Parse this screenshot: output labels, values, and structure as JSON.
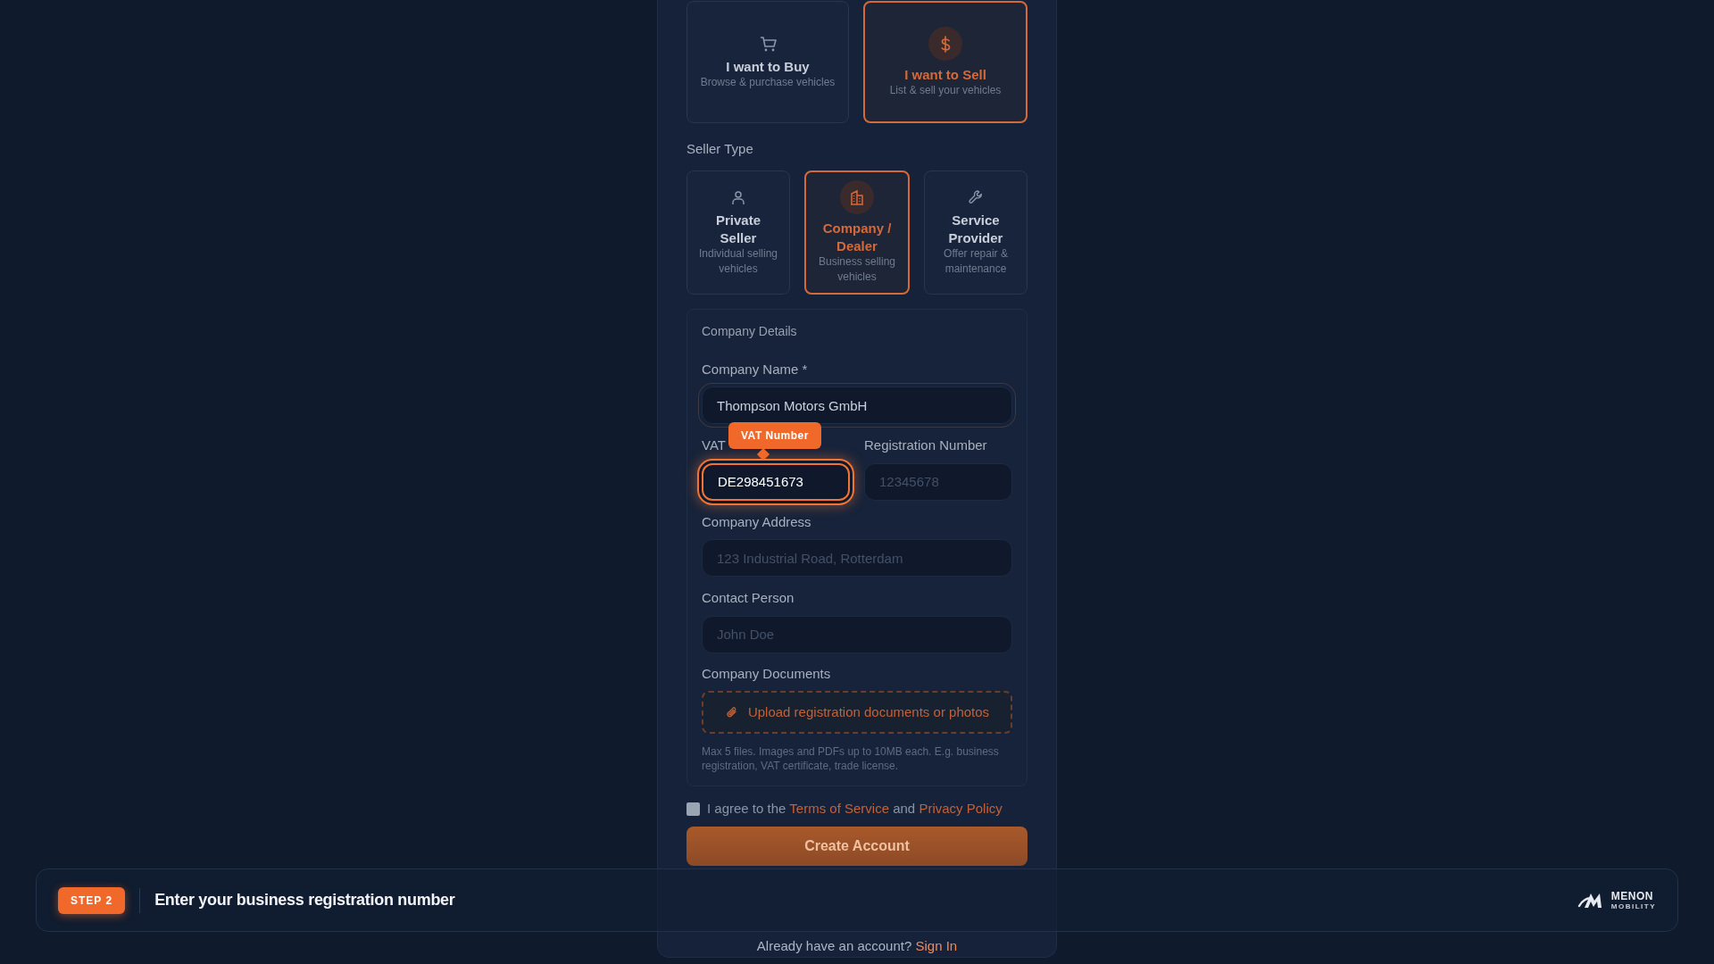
{
  "purpose": [
    {
      "title": "I want to Buy",
      "subtitle": "Browse & purchase vehicles",
      "selected": false
    },
    {
      "title": "I want to Sell",
      "subtitle": "List & sell your vehicles",
      "selected": true
    }
  ],
  "seller_type": {
    "label": "Seller Type",
    "options": [
      {
        "title": "Private Seller",
        "subtitle": "Individual selling vehicles",
        "selected": false
      },
      {
        "title": "Company / Dealer",
        "subtitle": "Business selling vehicles",
        "selected": true
      },
      {
        "title": "Service Provider",
        "subtitle": "Offer repair & maintenance",
        "selected": false
      }
    ]
  },
  "company_details": {
    "title": "Company Details",
    "rows": [
      {
        "fields": [
          {
            "label": "Company Name *",
            "value": "Thompson Motors GmbH",
            "focused": false
          }
        ]
      },
      {
        "fields": [
          {
            "label": "VAT",
            "value": "DE298451673",
            "focused": true,
            "tooltip": "VAT Number"
          },
          {
            "label": "Registration Number",
            "placeholder": "12345678",
            "focused": false
          }
        ]
      },
      {
        "fields": [
          {
            "label": "Company Address",
            "placeholder": "123 Industrial Road, Rotterdam",
            "focused": false
          }
        ]
      },
      {
        "fields": [
          {
            "label": "Contact Person",
            "placeholder": "John Doe",
            "focused": false
          }
        ]
      }
    ],
    "documents": {
      "label": "Company Documents",
      "upload": "Upload registration documents or photos",
      "help": "Max 5 files. Images and PDFs up to 10MB each. E.g. business registration, VAT certificate, trade license."
    }
  },
  "agree": {
    "checked": false,
    "parts": [
      {
        "kind": "text",
        "text": "I agree to the"
      },
      {
        "kind": "link",
        "text": "Terms of Service"
      },
      {
        "kind": "text",
        "text": "and"
      },
      {
        "kind": "link",
        "text": "Privacy Policy"
      }
    ]
  },
  "submit": "Create Account",
  "signin": {
    "parts": [
      {
        "kind": "text",
        "text": "Already have an account?"
      },
      {
        "kind": "link",
        "text": "Sign In"
      }
    ]
  },
  "banner": {
    "step": "STEP 2",
    "text": "Enter your business registration number",
    "logo": {
      "name": "MENON",
      "tagline": "MOBILITY"
    }
  }
}
